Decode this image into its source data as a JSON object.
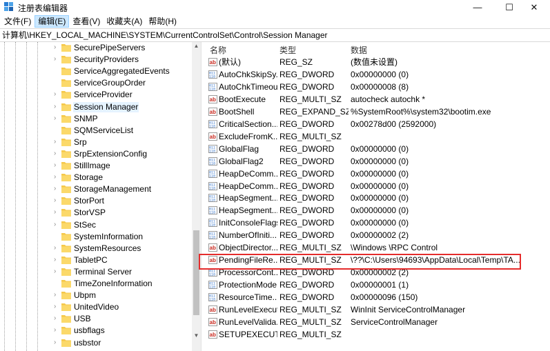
{
  "window": {
    "title": "注册表编辑器",
    "controls": {
      "minimize": "—",
      "maximize": "☐",
      "close": "✕"
    }
  },
  "menu": [
    {
      "label": "文件(F)",
      "active": false
    },
    {
      "label": "编辑(E)",
      "active": true
    },
    {
      "label": "查看(V)",
      "active": false
    },
    {
      "label": "收藏夹(A)",
      "active": false
    },
    {
      "label": "帮助(H)",
      "active": false
    }
  ],
  "address": "计算机\\HKEY_LOCAL_MACHINE\\SYSTEM\\CurrentControlSet\\Control\\Session Manager",
  "tree": {
    "items": [
      {
        "label": "SecurePipeServers",
        "expandable": true
      },
      {
        "label": "SecurityProviders",
        "expandable": true
      },
      {
        "label": "ServiceAggregatedEvents",
        "expandable": false
      },
      {
        "label": "ServiceGroupOrder",
        "expandable": false
      },
      {
        "label": "ServiceProvider",
        "expandable": true
      },
      {
        "label": "Session Manager",
        "expandable": true,
        "selected": true
      },
      {
        "label": "SNMP",
        "expandable": true
      },
      {
        "label": "SQMServiceList",
        "expandable": false
      },
      {
        "label": "Srp",
        "expandable": true
      },
      {
        "label": "SrpExtensionConfig",
        "expandable": true
      },
      {
        "label": "StillImage",
        "expandable": true
      },
      {
        "label": "Storage",
        "expandable": true
      },
      {
        "label": "StorageManagement",
        "expandable": true
      },
      {
        "label": "StorPort",
        "expandable": true
      },
      {
        "label": "StorVSP",
        "expandable": true
      },
      {
        "label": "StSec",
        "expandable": true
      },
      {
        "label": "SystemInformation",
        "expandable": false
      },
      {
        "label": "SystemResources",
        "expandable": true
      },
      {
        "label": "TabletPC",
        "expandable": true
      },
      {
        "label": "Terminal Server",
        "expandable": true
      },
      {
        "label": "TimeZoneInformation",
        "expandable": false
      },
      {
        "label": "Ubpm",
        "expandable": true
      },
      {
        "label": "UnitedVideo",
        "expandable": true
      },
      {
        "label": "USB",
        "expandable": true
      },
      {
        "label": "usbflags",
        "expandable": true
      },
      {
        "label": "usbstor",
        "expandable": true
      }
    ]
  },
  "list": {
    "columns": {
      "name": "名称",
      "type": "类型",
      "data": "数据"
    },
    "rows": [
      {
        "icon": "string-value-icon",
        "name": "(默认)",
        "type": "REG_SZ",
        "data": "(数值未设置)"
      },
      {
        "icon": "binary-value-icon",
        "name": "AutoChkSkipSy...",
        "type": "REG_DWORD",
        "data": "0x00000000 (0)"
      },
      {
        "icon": "binary-value-icon",
        "name": "AutoChkTimeout",
        "type": "REG_DWORD",
        "data": "0x00000008 (8)"
      },
      {
        "icon": "string-value-icon",
        "name": "BootExecute",
        "type": "REG_MULTI_SZ",
        "data": "autocheck autochk *"
      },
      {
        "icon": "string-value-icon",
        "name": "BootShell",
        "type": "REG_EXPAND_SZ",
        "data": "%SystemRoot%\\system32\\bootim.exe"
      },
      {
        "icon": "binary-value-icon",
        "name": "CriticalSection...",
        "type": "REG_DWORD",
        "data": "0x00278d00 (2592000)"
      },
      {
        "icon": "string-value-icon",
        "name": "ExcludeFromK...",
        "type": "REG_MULTI_SZ",
        "data": ""
      },
      {
        "icon": "binary-value-icon",
        "name": "GlobalFlag",
        "type": "REG_DWORD",
        "data": "0x00000000 (0)"
      },
      {
        "icon": "binary-value-icon",
        "name": "GlobalFlag2",
        "type": "REG_DWORD",
        "data": "0x00000000 (0)"
      },
      {
        "icon": "binary-value-icon",
        "name": "HeapDeComm...",
        "type": "REG_DWORD",
        "data": "0x00000000 (0)"
      },
      {
        "icon": "binary-value-icon",
        "name": "HeapDeComm...",
        "type": "REG_DWORD",
        "data": "0x00000000 (0)"
      },
      {
        "icon": "binary-value-icon",
        "name": "HeapSegment...",
        "type": "REG_DWORD",
        "data": "0x00000000 (0)"
      },
      {
        "icon": "binary-value-icon",
        "name": "HeapSegment...",
        "type": "REG_DWORD",
        "data": "0x00000000 (0)"
      },
      {
        "icon": "binary-value-icon",
        "name": "InitConsoleFlags",
        "type": "REG_DWORD",
        "data": "0x00000000 (0)"
      },
      {
        "icon": "binary-value-icon",
        "name": "NumberOfIniti...",
        "type": "REG_DWORD",
        "data": "0x00000002 (2)"
      },
      {
        "icon": "string-value-icon",
        "name": "ObjectDirector...",
        "type": "REG_MULTI_SZ",
        "data": "\\Windows \\RPC Control"
      },
      {
        "icon": "string-value-icon",
        "name": "PendingFileRe...",
        "type": "REG_MULTI_SZ",
        "data": "\\??\\C:\\Users\\94693\\AppData\\Local\\Temp\\TA...",
        "highlighted": true
      },
      {
        "icon": "binary-value-icon",
        "name": "ProcessorCont...",
        "type": "REG_DWORD",
        "data": "0x00000002 (2)"
      },
      {
        "icon": "binary-value-icon",
        "name": "ProtectionMode",
        "type": "REG_DWORD",
        "data": "0x00000001 (1)"
      },
      {
        "icon": "binary-value-icon",
        "name": "ResourceTime...",
        "type": "REG_DWORD",
        "data": "0x00000096 (150)"
      },
      {
        "icon": "string-value-icon",
        "name": "RunLevelExecute",
        "type": "REG_MULTI_SZ",
        "data": "WinInit ServiceControlManager"
      },
      {
        "icon": "string-value-icon",
        "name": "RunLevelValida...",
        "type": "REG_MULTI_SZ",
        "data": "ServiceControlManager"
      },
      {
        "icon": "string-value-icon",
        "name": "SETUPEXECUTE",
        "type": "REG_MULTI_SZ",
        "data": ""
      }
    ]
  },
  "colors": {
    "highlight_border": "#e52b2b",
    "folder": "#f5c84a",
    "selection": "#e5f3ff",
    "menu_active": "#cce8ff",
    "string_icon_red": "#c8281e",
    "binary_icon_blue": "#2a6dc9"
  }
}
